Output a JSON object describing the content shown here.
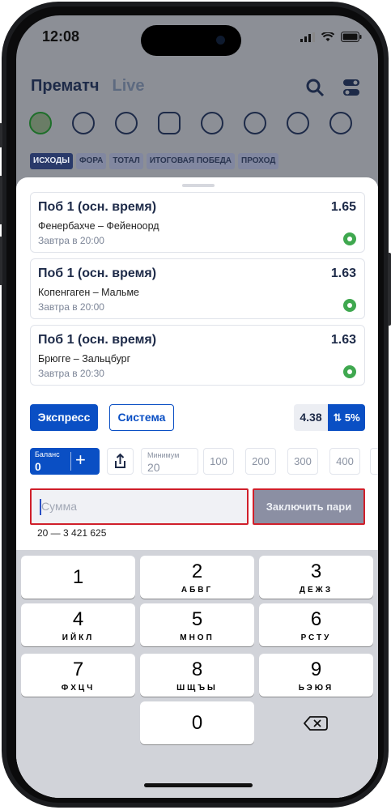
{
  "status_bar": {
    "time": "12:08"
  },
  "header": {
    "tab_prematch": "Прематч",
    "tab_live": "Live",
    "market_tabs": [
      "ИСХОДЫ",
      "ФОРА",
      "ТОТАЛ",
      "ИТОГОВАЯ ПОБЕДА",
      "ПРОХОД"
    ]
  },
  "bets": [
    {
      "title": "Поб 1 (осн. время)",
      "odd": "1.65",
      "match": "Фенербахче – Фейеноорд",
      "time": "Завтра в 20:00"
    },
    {
      "title": "Поб 1 (осн. время)",
      "odd": "1.63",
      "match": "Копенгаген – Мальме",
      "time": "Завтра в 20:00"
    },
    {
      "title": "Поб 1 (осн. время)",
      "odd": "1.63",
      "match": "Брюгге – Зальцбург",
      "time": "Завтра в 20:30"
    }
  ],
  "bet_type": {
    "express": "Экспресс",
    "system": "Система"
  },
  "total_odd": "4.38",
  "boost": "⇅ 5%",
  "balance": {
    "label": "Баланс",
    "value": "0",
    "plus": "+"
  },
  "minimum": {
    "label": "Минимум",
    "value": "20"
  },
  "quick_amounts": [
    "100",
    "200",
    "300",
    "400"
  ],
  "amount": {
    "placeholder": "Сумма",
    "range": "20 — 3 421 625"
  },
  "place_bet": "Заключить пари",
  "keyboard": [
    {
      "num": "1",
      "letters": ""
    },
    {
      "num": "2",
      "letters": "АБВГ"
    },
    {
      "num": "3",
      "letters": "ДЕЖЗ"
    },
    {
      "num": "4",
      "letters": "ИЙКЛ"
    },
    {
      "num": "5",
      "letters": "МНОП"
    },
    {
      "num": "6",
      "letters": "РСТУ"
    },
    {
      "num": "7",
      "letters": "ФХЦЧ"
    },
    {
      "num": "8",
      "letters": "ШЩЪЫ"
    },
    {
      "num": "9",
      "letters": "ЬЭЮЯ"
    },
    {
      "num": "0",
      "letters": ""
    }
  ],
  "colors": {
    "accent": "#0a4fc4",
    "error_border": "#d01f2a",
    "ball_green": "#3fa84f"
  }
}
